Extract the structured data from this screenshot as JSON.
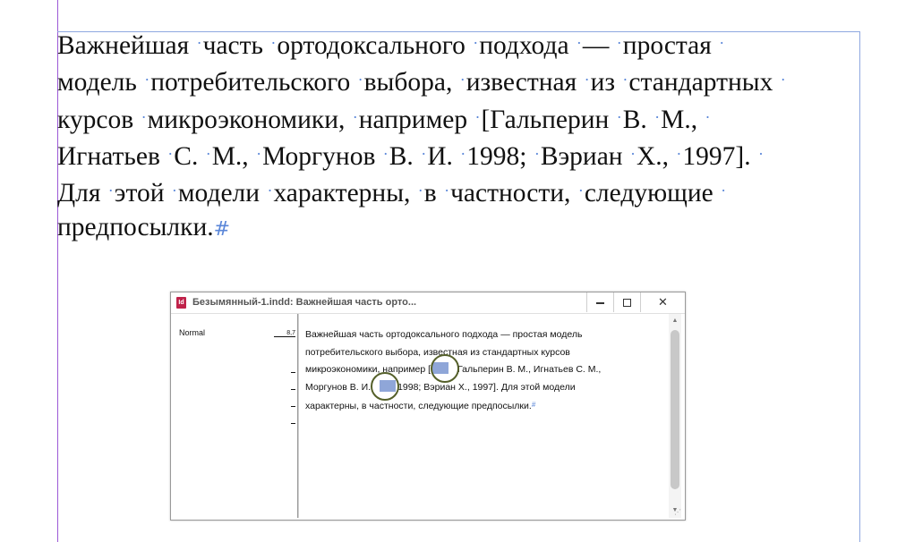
{
  "document": {
    "lines": [
      "Важнейшая часть ортодоксального подхода — простая",
      "модель потребительского выбора, известная из стандартных",
      "курсов микроэкономики, например [Гальперин В. М.,",
      "Игнатьев С. М., Моргунов В. И. 1998; Вэриан Х., 1997].",
      "Для этой модели характерны, в частности, следующие",
      "предпосылки."
    ],
    "end_marker": "#"
  },
  "story_editor": {
    "title": "Безымянный-1.indd: Важнейшая часть орто...",
    "app_icon": "Id",
    "style_name": "Normal",
    "depth": "8,7",
    "lines": [
      "Важнейшая часть ортодоксального подхода — простая модель",
      "потребительского выбора, известная из стандартных курсов",
      "микроэкономики, например [",
      "Гальперин В. М., Игнатьев С. М.,",
      "Моргунов В. И.",
      "1998; Вэриан Х., 1997]. Для этой модели",
      "характерны, в частности, следующие предпосылки."
    ],
    "end_marker": "#",
    "icons": {
      "minimize": "minimize-icon",
      "maximize": "maximize-icon",
      "close": "close-icon"
    }
  },
  "colors": {
    "guide_purple": "#9b59d6",
    "frame_blue": "#8fa8e0",
    "hidden_chars": "#5a86d8",
    "tag_ring": "#55602a"
  }
}
